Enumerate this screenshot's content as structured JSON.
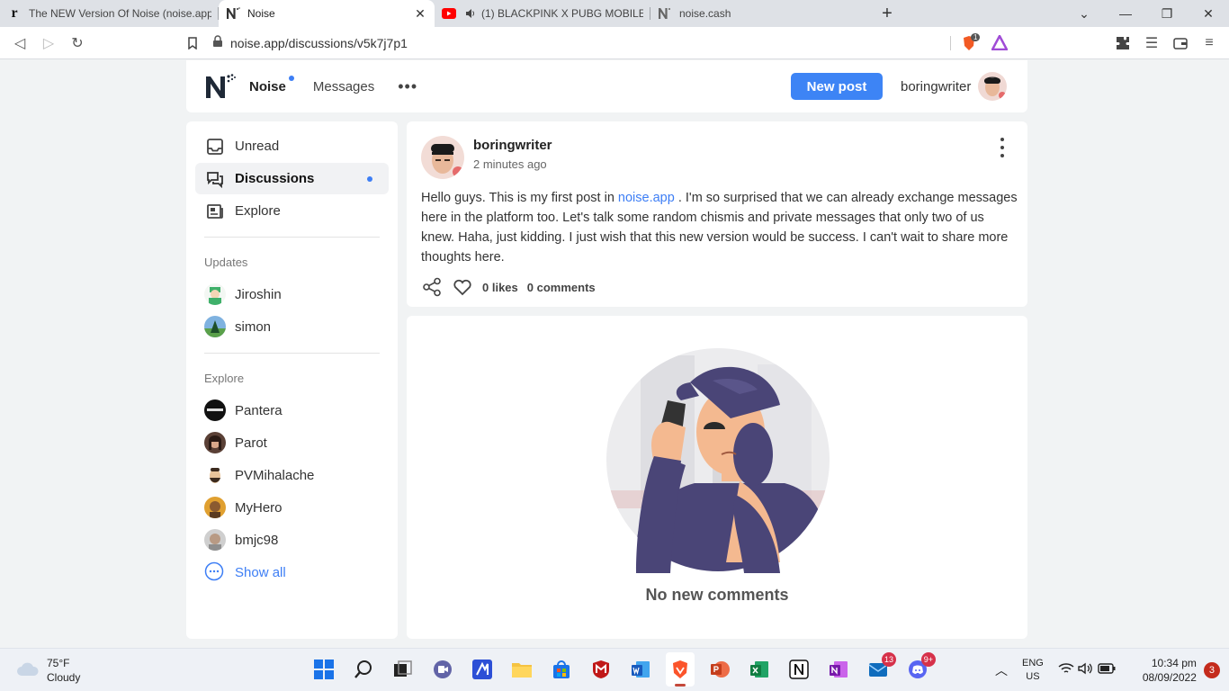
{
  "browser": {
    "tabs": [
      {
        "title": "The NEW Version Of Noise (noise.app)",
        "favicon": "r-logo-icon"
      },
      {
        "title": "Noise",
        "favicon": "noise-logo-icon",
        "active": true
      },
      {
        "title": "(1) BLACKPINK X PUBG MOBILE -",
        "favicon": "youtube-icon"
      },
      {
        "title": "noise.cash",
        "favicon": "noise-logo-icon"
      }
    ],
    "url": "noise.app/discussions/v5k7j7p1",
    "brave_badge": "1"
  },
  "header": {
    "nav_noise": "Noise",
    "nav_messages": "Messages",
    "nav_more": "•••",
    "new_post": "New post",
    "username": "boringwriter"
  },
  "sidebar": {
    "items": [
      {
        "label": "Unread",
        "icon": "inbox-icon"
      },
      {
        "label": "Discussions",
        "icon": "chat-bubbles-icon"
      },
      {
        "label": "Explore",
        "icon": "newspaper-icon"
      }
    ],
    "updates_heading": "Updates",
    "updates": [
      {
        "name": "Jiroshin"
      },
      {
        "name": "simon"
      }
    ],
    "explore_heading": "Explore",
    "explore": [
      {
        "name": "Pantera"
      },
      {
        "name": "Parot"
      },
      {
        "name": "PVMihalache"
      },
      {
        "name": "MyHero"
      },
      {
        "name": "bmjc98"
      }
    ],
    "show_all": "Show all"
  },
  "post": {
    "author": "boringwriter",
    "time": "2 minutes ago",
    "body_before": "Hello guys. This is my first post in ",
    "body_link": "noise.app",
    "body_after": " . I'm so surprised that we can already exchange messages here in the platform too. Let's talk some random chismis and private messages that only two of us knew. Haha, just kidding. I just wish that this new version would be success. I can't wait to share more thoughts here.",
    "likes": "0 likes",
    "comments": "0 comments"
  },
  "comments": {
    "empty_text": "No new comments"
  },
  "taskbar": {
    "weather_temp": "75°F",
    "weather_desc": "Cloudy",
    "badge_mail": "13",
    "badge_discord": "9+",
    "lang_top": "ENG",
    "lang_bottom": "US",
    "time": "10:34 pm",
    "date": "08/09/2022",
    "notifications": "3"
  }
}
